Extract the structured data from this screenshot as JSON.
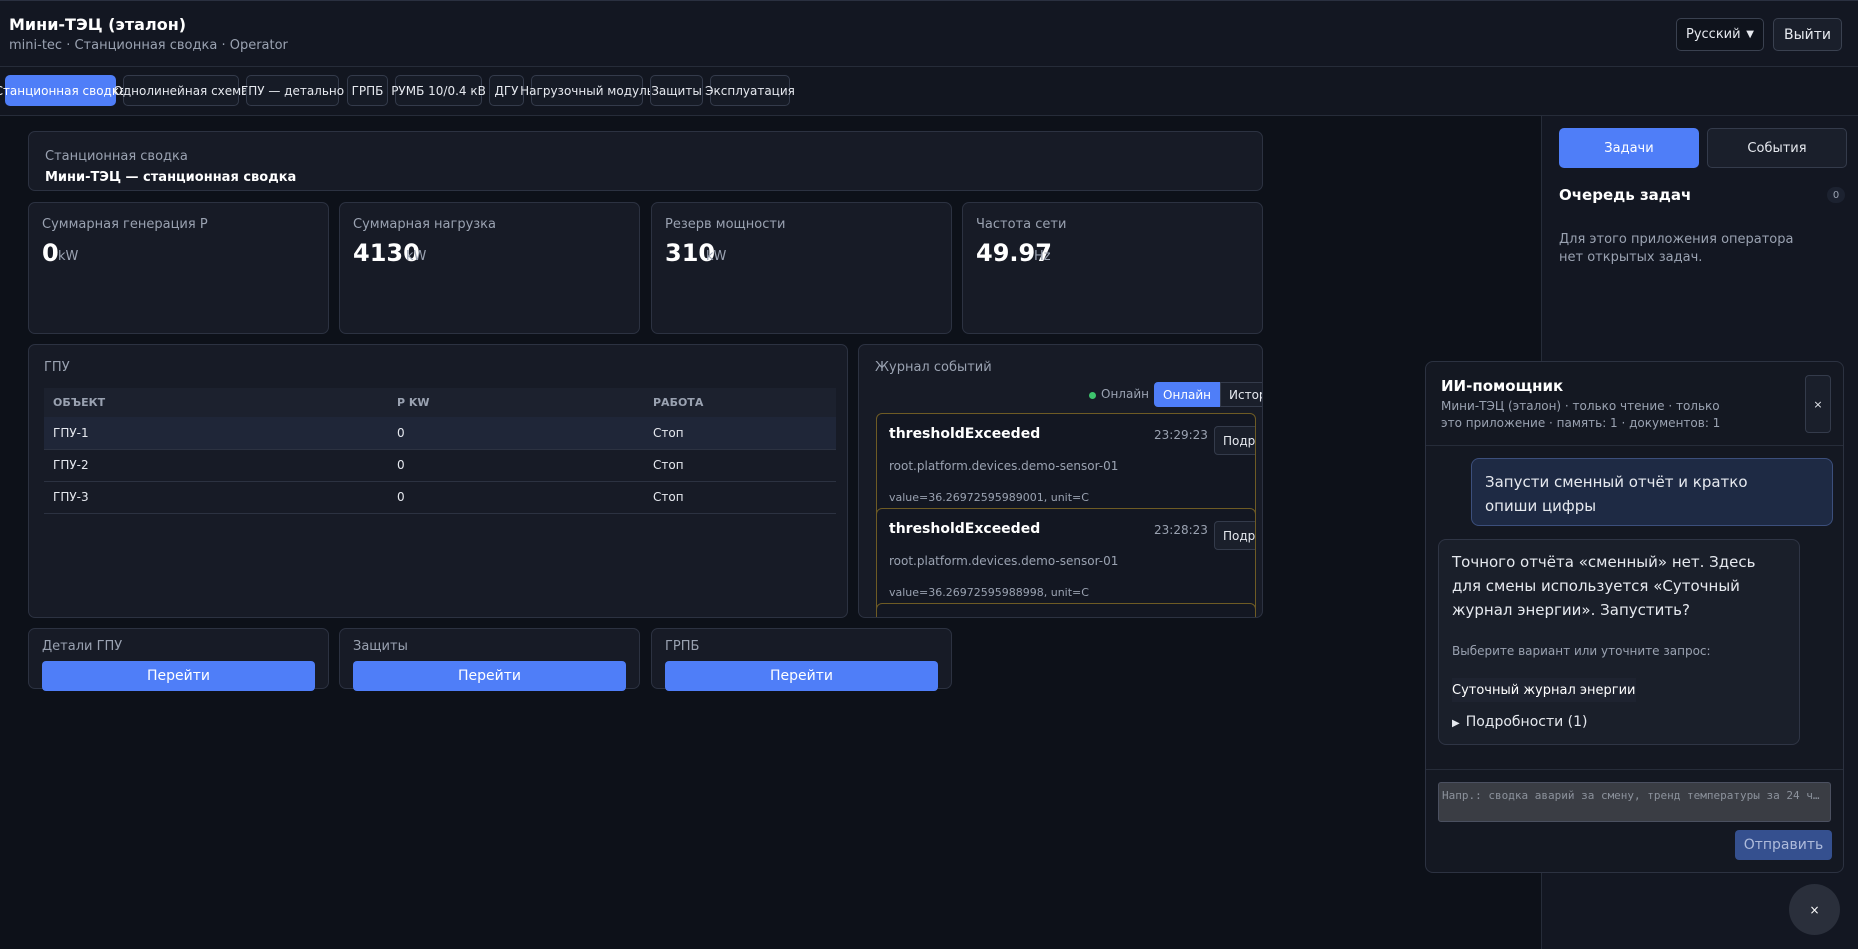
{
  "header": {
    "title": "Мини-ТЭЦ (эталон)",
    "subtitle": "mini-tec · Станционная сводка · Operator",
    "language": "Русский",
    "logout_label": "Выйти"
  },
  "tabs": [
    {
      "label": "Станционная сводка",
      "active": true
    },
    {
      "label": "Однолинейная схема"
    },
    {
      "label": "ГПУ — детально"
    },
    {
      "label": "ГРПБ"
    },
    {
      "label": "РУМБ 10/0.4 кВ"
    },
    {
      "label": "ДГУ"
    },
    {
      "label": "Нагрузочный модуль"
    },
    {
      "label": "Защиты"
    },
    {
      "label": "Эксплуатация"
    }
  ],
  "summary": {
    "label": "Станционная сводка",
    "title": "Мини-ТЭЦ — станционная сводка"
  },
  "kpis": [
    {
      "label": "Суммарная генерация P",
      "value": "0",
      "unit": "kW"
    },
    {
      "label": "Суммарная нагрузка",
      "value": "4130",
      "unit": "kW"
    },
    {
      "label": "Резерв мощности",
      "value": "310",
      "unit": "kW"
    },
    {
      "label": "Частота сети",
      "value": "49.97",
      "unit": "Hz"
    }
  ],
  "gpu": {
    "title": "ГПУ",
    "columns": [
      "ОБЪЕКТ",
      "P KW",
      "РАБОТА"
    ],
    "rows": [
      [
        "ГПУ-1",
        "0",
        "Стоп"
      ],
      [
        "ГПУ-2",
        "0",
        "Стоп"
      ],
      [
        "ГПУ-3",
        "0",
        "Стоп"
      ]
    ]
  },
  "journal": {
    "title": "Журнал событий",
    "status": "Онлайн",
    "seg_online": "Онлайн",
    "seg_history": "История",
    "events": [
      {
        "name": "thresholdExceeded",
        "time": "23:29:23",
        "path": "root.platform.devices.demo-sensor-01",
        "value": "value=36.26972595989001, unit=C",
        "more": "Подробнее"
      },
      {
        "name": "thresholdExceeded",
        "time": "23:28:23",
        "path": "root.platform.devices.demo-sensor-01",
        "value": "value=36.26972595988998, unit=C",
        "more": "Подробнее"
      }
    ]
  },
  "links": [
    {
      "label": "Детали ГПУ",
      "button": "Перейти"
    },
    {
      "label": "Защиты",
      "button": "Перейти"
    },
    {
      "label": "ГРПБ",
      "button": "Перейти"
    }
  ],
  "sidebar": {
    "tasks_label": "Задачи",
    "events_label": "События",
    "queue_title": "Очередь задач",
    "queue_count": "0",
    "queue_empty": "Для этого приложения оператора нет открытых задач."
  },
  "assistant": {
    "title": "ИИ-помощник",
    "subtitle": "Мини-ТЭЦ (эталон) · только чтение · только это приложение · память: 1 · документов: 1",
    "close_icon": "×",
    "user_message": "Запусти сменный отчёт и кратко опиши цифры",
    "bot_message": "Точного отчёта «сменный» нет. Здесь для смены используется «Суточный журнал энергии». Запустить?",
    "bot_hint": "Выберите вариант или уточните запрос:",
    "bot_option": "Суточный журнал энергии",
    "bot_details": "Подробности (1)",
    "input_placeholder": "Напр.: сводка аварий за смену, тренд температуры за 24 ч…",
    "send_label": "Отправить"
  },
  "fab_icon": "×",
  "colors": {
    "accent": "#4f7ef8",
    "background": "#0d1119",
    "panel": "#171b26",
    "online": "#3ec46d",
    "event_border": "#6e5b24"
  }
}
